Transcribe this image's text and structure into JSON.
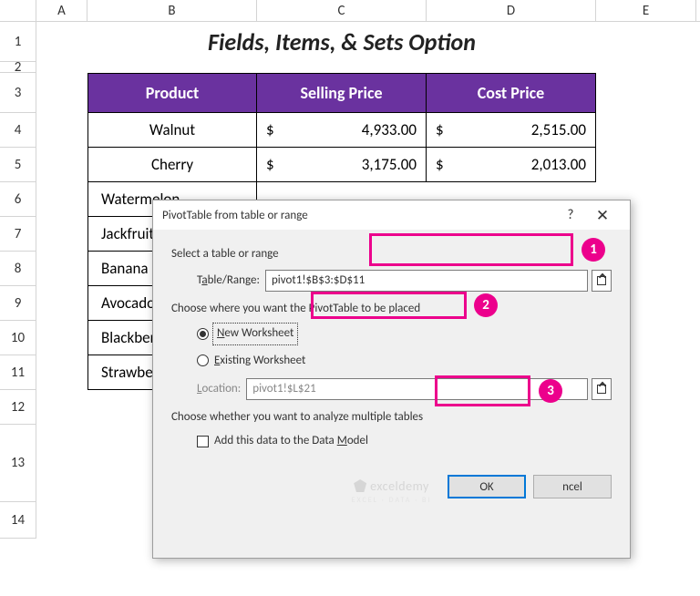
{
  "columns": [
    "A",
    "B",
    "C",
    "D",
    "E"
  ],
  "rows": [
    "1",
    "2",
    "3",
    "4",
    "5",
    "6",
    "7",
    "8",
    "9",
    "10",
    "11",
    "12",
    "13",
    "14"
  ],
  "title": "Fields, Items, & Sets Option",
  "headers": {
    "product": "Product",
    "selling": "Selling Price",
    "cost": "Cost Price"
  },
  "table": [
    {
      "product": "Walnut",
      "selling": "4,933.00",
      "cost": "2,515.00"
    },
    {
      "product": "Cherry",
      "selling": "3,175.00",
      "cost": "2,013.00"
    },
    {
      "product": "Watermelon"
    },
    {
      "product": "Jackfruit"
    },
    {
      "product": "Banana"
    },
    {
      "product": "Avocado"
    },
    {
      "product": "Blackberry"
    },
    {
      "product": "Strawberry"
    }
  ],
  "currency": "$",
  "dialog": {
    "title": "PivotTable from table or range",
    "help": "?",
    "close": "✕",
    "section1": "Select a table or range",
    "tablerange_label_pre": "T",
    "tablerange_label_und": "a",
    "tablerange_label_post": "ble/Range:",
    "tablerange_value": "pivot1!$B$3:$D$11",
    "section2": "Choose where you want the PivotTable to be placed",
    "radio1_pre": "",
    "radio1_und": "N",
    "radio1_post": "ew Worksheet",
    "radio2_pre": "",
    "radio2_und": "E",
    "radio2_post": "xisting Worksheet",
    "location_label_pre": "",
    "location_label_und": "L",
    "location_label_post": "ocation:",
    "location_value": "pivot1!$L$21",
    "section3": "Choose whether you want to analyze multiple tables",
    "checkbox_label": "Add this data to the Data ",
    "checkbox_und": "M",
    "checkbox_post": "odel",
    "ok": "OK",
    "cancel": "ncel"
  },
  "badges": {
    "b1": "1",
    "b2": "2",
    "b3": "3"
  },
  "watermark": {
    "brand": "exceldemy",
    "sub": "EXCEL · DATA · BI"
  }
}
